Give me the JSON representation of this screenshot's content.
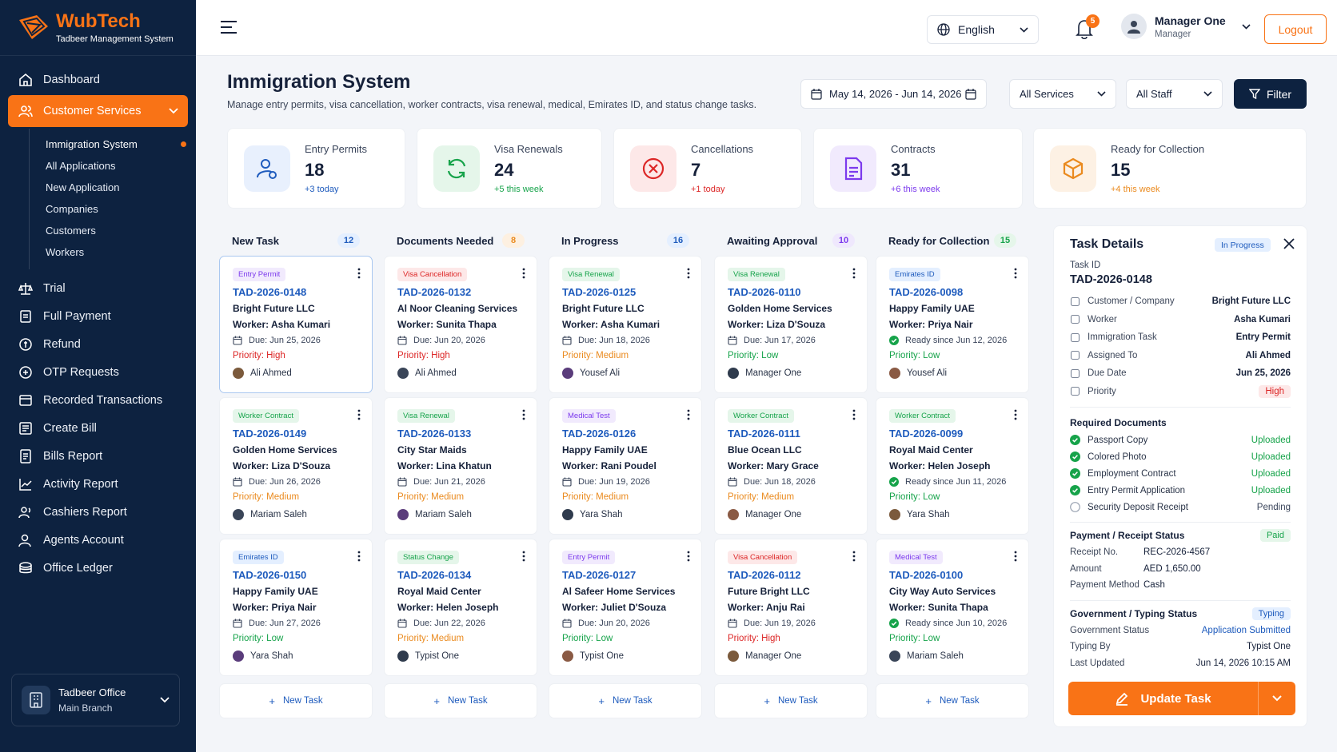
{
  "brand": {
    "name": "WubTech",
    "subtitle": "Tadbeer Management System"
  },
  "sidebar": {
    "dashboard": "Dashboard",
    "customer_services": "Customer Services",
    "sub": [
      "Immigration System",
      "All Applications",
      "New Application",
      "Companies",
      "Customers",
      "Workers"
    ],
    "items": [
      "Trial",
      "Full Payment",
      "Refund",
      "OTP Requests",
      "Recorded Transactions",
      "Create Bill",
      "Bills Report",
      "Activity Report",
      "Cashiers Report",
      "Agents Account",
      "Office Ledger"
    ],
    "office": {
      "name": "Tadbeer Office",
      "branch": "Main Branch"
    }
  },
  "topbar": {
    "language": "English",
    "notif_count": "5",
    "user_name": "Manager One",
    "user_role": "Manager",
    "logout": "Logout"
  },
  "page": {
    "title": "Immigration System",
    "subtitle": "Manage entry permits, visa cancellation, worker contracts, visa renewal, medical, Emirates ID, and status change tasks."
  },
  "filters": {
    "date_range": "May 14, 2026 - Jun 14, 2026",
    "services": "All Services",
    "staff": "All Staff",
    "filter": "Filter"
  },
  "stats": [
    {
      "label": "Entry Permits",
      "value": "18",
      "sub": "+3 today",
      "color": "#1e5bbd"
    },
    {
      "label": "Visa Renewals",
      "value": "24",
      "sub": "+5 this week",
      "color": "#16a34a"
    },
    {
      "label": "Cancellations",
      "value": "7",
      "sub": "+1 today",
      "color": "#dc2626"
    },
    {
      "label": "Contracts",
      "value": "31",
      "sub": "+6 this week",
      "color": "#7c3aed"
    },
    {
      "label": "Ready for Collection",
      "value": "15",
      "sub": "+4 this week",
      "color": "#ea8a1e"
    }
  ],
  "columns": [
    {
      "title": "New Task",
      "count": "12",
      "new_task": "New Task",
      "cards": [
        {
          "tag": "Entry Permit",
          "id": "TAD-2026-0148",
          "company": "Bright Future LLC",
          "worker": "Worker: Asha Kumari",
          "due": "Due: Jun 25, 2026",
          "priority": "Priority: High",
          "assignee": "Ali Ahmed"
        },
        {
          "tag": "Worker Contract",
          "id": "TAD-2026-0149",
          "company": "Golden Home Services",
          "worker": "Worker: Liza D'Souza",
          "due": "Due: Jun 26, 2026",
          "priority": "Priority: Medium",
          "assignee": "Mariam Saleh"
        },
        {
          "tag": "Emirates ID",
          "id": "TAD-2026-0150",
          "company": "Happy Family UAE",
          "worker": "Worker: Priya Nair",
          "due": "Due: Jun 27, 2026",
          "priority": "Priority: Low",
          "assignee": "Yara Shah"
        }
      ]
    },
    {
      "title": "Documents Needed",
      "count": "8",
      "new_task": "New Task",
      "cards": [
        {
          "tag": "Visa Cancellation",
          "id": "TAD-2026-0132",
          "company": "Al Noor Cleaning Services",
          "worker": "Worker: Sunita Thapa",
          "due": "Due: Jun 20, 2026",
          "priority": "Priority: High",
          "assignee": "Ali Ahmed"
        },
        {
          "tag": "Visa Renewal",
          "id": "TAD-2026-0133",
          "company": "City Star Maids",
          "worker": "Worker: Lina Khatun",
          "due": "Due: Jun 21, 2026",
          "priority": "Priority: Medium",
          "assignee": "Mariam Saleh"
        },
        {
          "tag": "Status Change",
          "id": "TAD-2026-0134",
          "company": "Royal Maid Center",
          "worker": "Worker: Helen Joseph",
          "due": "Due: Jun 22, 2026",
          "priority": "Priority: Medium",
          "assignee": "Typist One"
        }
      ]
    },
    {
      "title": "In Progress",
      "count": "16",
      "new_task": "New Task",
      "cards": [
        {
          "tag": "Visa Renewal",
          "id": "TAD-2026-0125",
          "company": "Bright Future LLC",
          "worker": "Worker: Asha Kumari",
          "due": "Due: Jun 18, 2026",
          "priority": "Priority: Medium",
          "assignee": "Yousef Ali"
        },
        {
          "tag": "Medical Test",
          "id": "TAD-2026-0126",
          "company": "Happy Family UAE",
          "worker": "Worker: Rani Poudel",
          "due": "Due: Jun 19, 2026",
          "priority": "Priority: Medium",
          "assignee": "Yara Shah"
        },
        {
          "tag": "Entry Permit",
          "id": "TAD-2026-0127",
          "company": "Al Safeer Home Services",
          "worker": "Worker: Juliet D'Souza",
          "due": "Due: Jun 20, 2026",
          "priority": "Priority: Low",
          "assignee": "Typist One"
        }
      ]
    },
    {
      "title": "Awaiting Approval",
      "count": "10",
      "new_task": "New Task",
      "cards": [
        {
          "tag": "Visa Renewal",
          "id": "TAD-2026-0110",
          "company": "Golden Home Services",
          "worker": "Worker: Liza D'Souza",
          "due": "Due: Jun 17, 2026",
          "priority": "Priority: Low",
          "assignee": "Manager One"
        },
        {
          "tag": "Worker Contract",
          "id": "TAD-2026-0111",
          "company": "Blue Ocean LLC",
          "worker": "Worker: Mary Grace",
          "due": "Due: Jun 18, 2026",
          "priority": "Priority: Medium",
          "assignee": "Manager One"
        },
        {
          "tag": "Visa Cancellation",
          "id": "TAD-2026-0112",
          "company": "Future Bright LLC",
          "worker": "Worker: Anju Rai",
          "due": "Due: Jun 19, 2026",
          "priority": "Priority: High",
          "assignee": "Manager One"
        }
      ]
    },
    {
      "title": "Ready for Collection",
      "count": "15",
      "new_task": "New Task",
      "cards": [
        {
          "tag": "Emirates ID",
          "id": "TAD-2026-0098",
          "company": "Happy Family UAE",
          "worker": "Worker: Priya Nair",
          "due": "Ready since Jun 12, 2026",
          "priority": "Priority: Low",
          "assignee": "Yousef Ali"
        },
        {
          "tag": "Worker Contract",
          "id": "TAD-2026-0099",
          "company": "Royal Maid Center",
          "worker": "Worker: Helen Joseph",
          "due": "Ready since Jun 11, 2026",
          "priority": "Priority: Low",
          "assignee": "Yara Shah"
        },
        {
          "tag": "Medical Test",
          "id": "TAD-2026-0100",
          "company": "City Way Auto Services",
          "worker": "Worker: Sunita Thapa",
          "due": "Ready since Jun 10, 2026",
          "priority": "Priority: Low",
          "assignee": "Mariam Saleh"
        }
      ]
    }
  ],
  "details": {
    "title": "Task Details",
    "status": "In Progress",
    "task_id_label": "Task ID",
    "task_id": "TAD-2026-0148",
    "rows": [
      {
        "label": "Customer / Company",
        "value": "Bright Future LLC"
      },
      {
        "label": "Worker",
        "value": "Asha Kumari"
      },
      {
        "label": "Immigration Task",
        "value": "Entry Permit"
      },
      {
        "label": "Assigned To",
        "value": "Ali Ahmed"
      },
      {
        "label": "Due Date",
        "value": "Jun 25, 2026"
      },
      {
        "label": "Priority",
        "value": "High"
      }
    ],
    "docs_title": "Required Documents",
    "docs": [
      {
        "name": "Passport Copy",
        "status": "Uploaded"
      },
      {
        "name": "Colored Photo",
        "status": "Uploaded"
      },
      {
        "name": "Employment Contract",
        "status": "Uploaded"
      },
      {
        "name": "Entry Permit Application",
        "status": "Uploaded"
      },
      {
        "name": "Security Deposit Receipt",
        "status": "Pending"
      }
    ],
    "payment_title": "Payment / Receipt Status",
    "payment_status": "Paid",
    "payment": [
      {
        "k": "Receipt No.",
        "v": "REC-2026-4567"
      },
      {
        "k": "Amount",
        "v": "AED 1,650.00"
      },
      {
        "k": "Payment Method",
        "v": "Cash"
      }
    ],
    "gov_title": "Government / Typing Status",
    "gov_status": "Typing",
    "gov": [
      {
        "k": "Government Status",
        "v": "Application Submitted"
      },
      {
        "k": "Typing By",
        "v": "Typist One"
      },
      {
        "k": "Last Updated",
        "v": "Jun 14, 2026 10:15 AM"
      }
    ],
    "update": "Update Task"
  }
}
